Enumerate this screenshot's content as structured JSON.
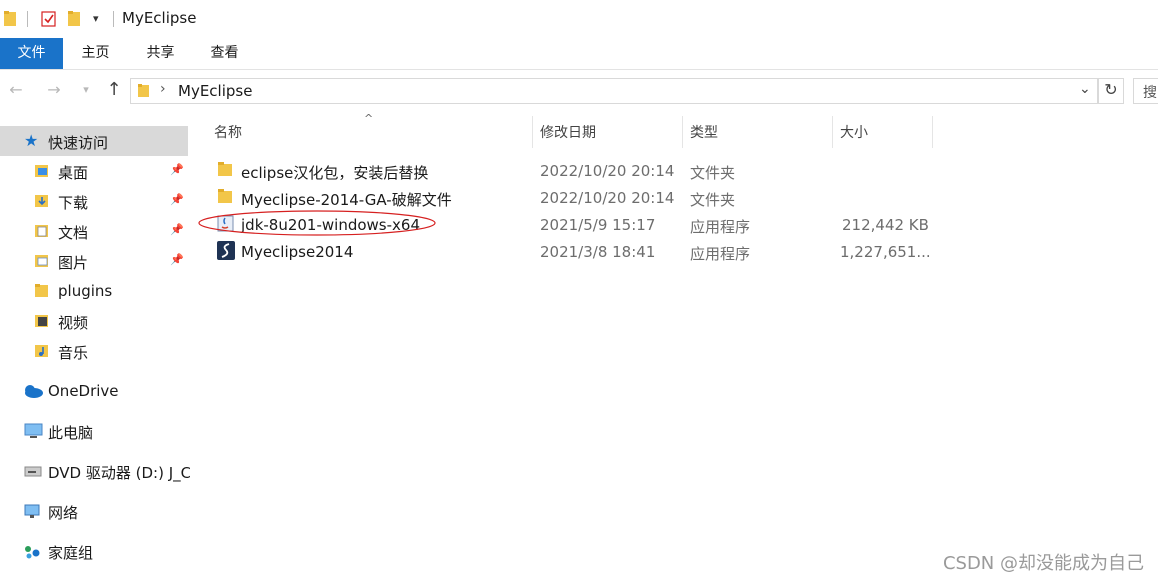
{
  "window": {
    "title": "MyEclipse"
  },
  "ribbon": {
    "tabs": [
      "文件",
      "主页",
      "共享",
      "查看"
    ]
  },
  "address": {
    "crumb": "MyEclipse",
    "search_placeholder": "搜"
  },
  "sidebar": {
    "items": [
      {
        "label": "快速访问",
        "icon": "star-icon",
        "pinned": false,
        "selected": true
      },
      {
        "label": "桌面",
        "icon": "desktop-folder-icon",
        "pinned": true
      },
      {
        "label": "下载",
        "icon": "download-folder-icon",
        "pinned": true
      },
      {
        "label": "文档",
        "icon": "documents-folder-icon",
        "pinned": true
      },
      {
        "label": "图片",
        "icon": "pictures-folder-icon",
        "pinned": true
      },
      {
        "label": "plugins",
        "icon": "folder-icon",
        "pinned": false
      },
      {
        "label": "视频",
        "icon": "videos-folder-icon",
        "pinned": false
      },
      {
        "label": "音乐",
        "icon": "music-folder-icon",
        "pinned": false
      },
      {
        "label": "OneDrive",
        "icon": "cloud-icon",
        "pinned": false
      },
      {
        "label": "此电脑",
        "icon": "computer-icon",
        "pinned": false
      },
      {
        "label": "DVD 驱动器 (D:) J_CC",
        "icon": "dvd-drive-icon",
        "pinned": false
      },
      {
        "label": "网络",
        "icon": "network-icon",
        "pinned": false
      },
      {
        "label": "家庭组",
        "icon": "homegroup-icon",
        "pinned": false
      }
    ]
  },
  "columns": {
    "name": "名称",
    "modified": "修改日期",
    "type": "类型",
    "size": "大小"
  },
  "files": [
    {
      "name": "eclipse汉化包，安装后替换",
      "modified": "2022/10/20 20:14",
      "type": "文件夹",
      "size": "",
      "icon": "folder-icon"
    },
    {
      "name": "Myeclipse-2014-GA-破解文件",
      "modified": "2022/10/20 20:14",
      "type": "文件夹",
      "size": "",
      "icon": "folder-icon"
    },
    {
      "name": "jdk-8u201-windows-x64",
      "modified": "2021/5/9 15:17",
      "type": "应用程序",
      "size": "212,442 KB",
      "icon": "java-installer-icon"
    },
    {
      "name": "Myeclipse2014",
      "modified": "2021/3/8 18:41",
      "type": "应用程序",
      "size": "1,227,651...",
      "icon": "myeclipse-app-icon"
    }
  ],
  "colors": {
    "accent": "#1a73c9",
    "selection": "#d9d9d9",
    "annotation": "#d62020"
  },
  "watermark": "CSDN @却没能成为自己"
}
